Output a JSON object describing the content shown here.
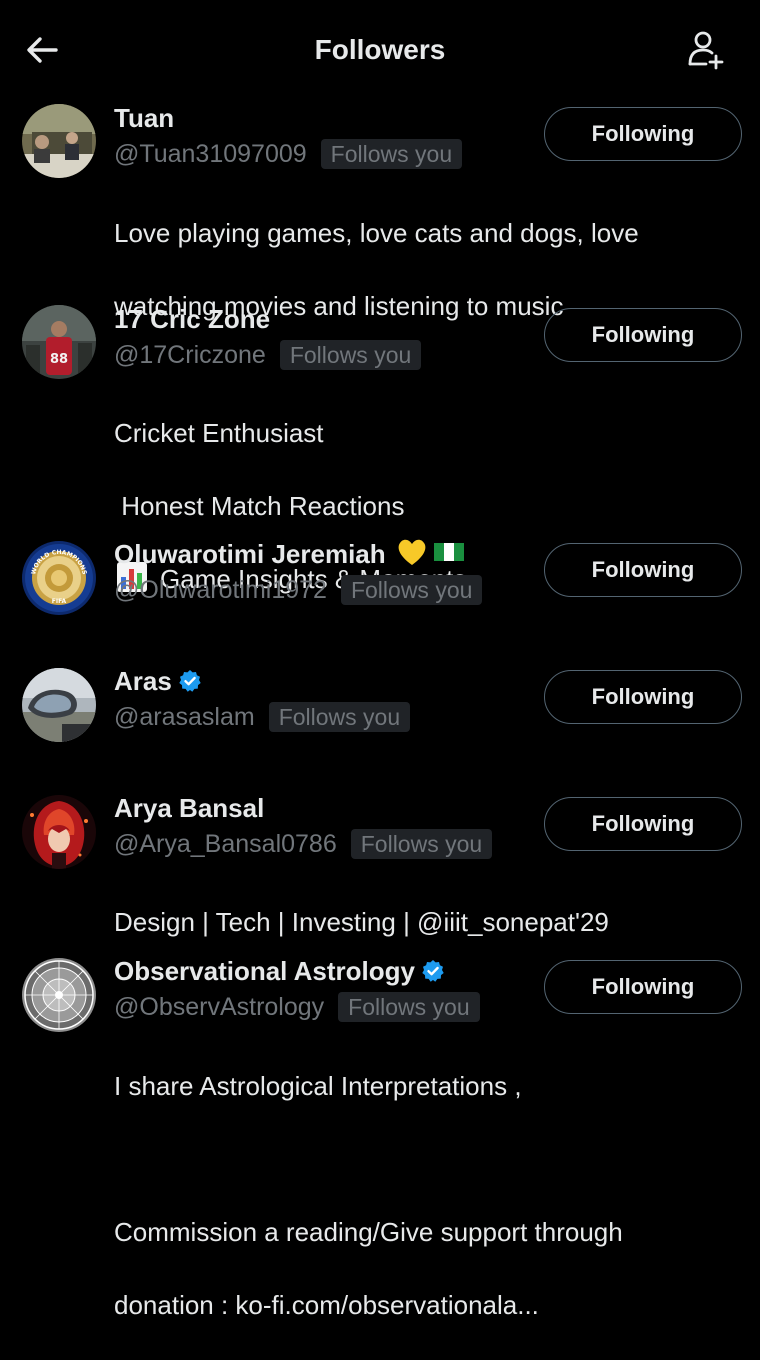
{
  "header": {
    "title": "Followers"
  },
  "followers": [
    {
      "name": "Tuan",
      "handle": "@Tuan31097009",
      "follows_badge": "Follows you",
      "button_label": "Following",
      "bio_lines": [
        "Love playing games, love cats and dogs, love",
        "watching movies and listening to music"
      ]
    },
    {
      "name": "17 Cric Zone",
      "handle": "@17Criczone",
      "follows_badge": "Follows you",
      "button_label": "Following",
      "bio_lines": [
        "Cricket Enthusiast",
        " Honest Match Reactions",
        "Game Insights & Moments"
      ]
    },
    {
      "name": "Oluwarotimi Jeremiah",
      "handle": "@Oluwarotimi1972",
      "follows_badge": "Follows you",
      "button_label": "Following",
      "avatar_text_top": "WORLD CHAMPIONS",
      "avatar_text_bottom": "FIFA"
    },
    {
      "name": "Aras",
      "handle": "@arasaslam",
      "follows_badge": "Follows you",
      "button_label": "Following"
    },
    {
      "name": "Arya Bansal",
      "handle": "@Arya_Bansal0786",
      "follows_badge": "Follows you",
      "button_label": "Following",
      "bio_lines": [
        "Design | Tech | Investing | @iiit_sonepat'29"
      ]
    },
    {
      "name": "Observational Astrology",
      "handle": "@ObservAstrology",
      "follows_badge": "Follows you",
      "button_label": "Following",
      "bio_lines": [
        "I share Astrological Interpretations ,",
        "",
        "Commission a reading/Give support through",
        "donation : ko-fi.com/observationala..."
      ]
    }
  ],
  "icons": {
    "back": "arrow-left-icon",
    "add_user": "add-user-icon",
    "verified": "verified-badge-icon",
    "heart": "yellow-heart-emoji",
    "flag": "nigeria-flag-emoji",
    "chart": "bar-chart-emoji"
  },
  "colors": {
    "background": "#000000",
    "text_primary": "#e7e9ea",
    "text_secondary": "#71767b",
    "badge_bg": "#202327",
    "button_border": "#536471",
    "verified_blue": "#1d9bf0"
  }
}
